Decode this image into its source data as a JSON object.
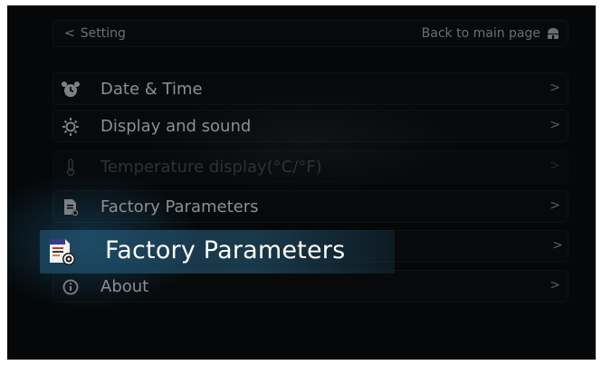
{
  "header": {
    "back_chevron": "<",
    "back_label": "Setting",
    "main_page_label": "Back to main page",
    "home_icon": "home-icon"
  },
  "menu": {
    "items": [
      {
        "label": "Date & Time",
        "icon": "alarm-clock-icon",
        "chevron": ">",
        "enabled": true
      },
      {
        "label": "Display and sound",
        "icon": "brightness-icon",
        "chevron": ">",
        "enabled": true
      },
      {
        "label": "Temperature display(°C/°F)",
        "icon": "thermometer-icon",
        "chevron": ">",
        "enabled": false
      },
      {
        "label": "Factory Parameters",
        "icon": "document-gear-icon",
        "chevron": ">",
        "enabled": true
      },
      {
        "label": "",
        "icon": "",
        "chevron": ">",
        "enabled": true
      },
      {
        "label": "About",
        "icon": "info-icon",
        "chevron": ">",
        "enabled": true
      }
    ]
  },
  "callout": {
    "label": "Factory Parameters",
    "icon": "document-gear-icon"
  },
  "colors": {
    "background": "#050708",
    "text": "#8b8f94",
    "callout": "#2d6a8c"
  }
}
